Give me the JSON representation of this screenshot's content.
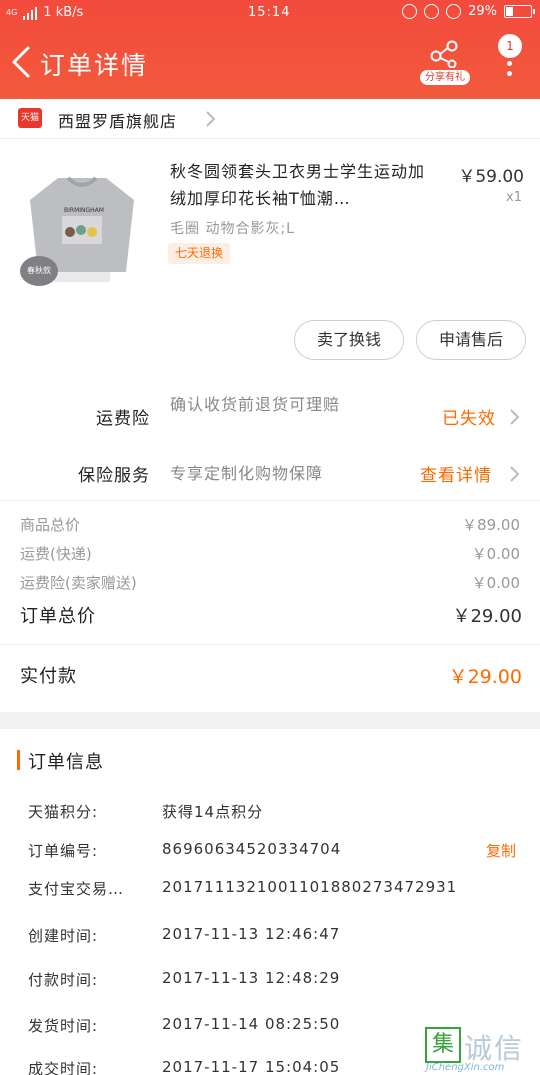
{
  "status_bar": {
    "network": "4G",
    "speed": "1 kB/s",
    "time": "15:14",
    "battery": "29%"
  },
  "header": {
    "title": "订单详情",
    "share_label": "分享有礼",
    "message_count": "1"
  },
  "shop": {
    "platform": "天猫",
    "name": "西盟罗盾旗舰店"
  },
  "product": {
    "title": "秋冬圆领套头卫衣男士学生运动加绒加厚印花长袖T恤潮…",
    "price": "￥59.00",
    "quantity": "x1",
    "sku": "毛圈 动物合影灰;L",
    "tag": "七天退换",
    "image_text": "BIRMINGHAM",
    "image_badge": "春秋款"
  },
  "actions": {
    "refund": "卖了换钱",
    "after_sales": "申请售后"
  },
  "services": [
    {
      "label": "运费险",
      "desc": "确认收货前退货可理赔",
      "status": "已失效"
    },
    {
      "label": "保险服务",
      "desc": "专享定制化购物保障",
      "status": "查看详情"
    }
  ],
  "fees": [
    {
      "label": "商品总价",
      "value": "￥89.00"
    },
    {
      "label": "运费(快递)",
      "value": "￥0.00"
    },
    {
      "label": "运费险(卖家赠送)",
      "value": "￥0.00"
    }
  ],
  "total": {
    "label": "订单总价",
    "value": "￥29.00"
  },
  "paid": {
    "label": "实付款",
    "value": "￥29.00"
  },
  "order_info": {
    "title": "订单信息",
    "copy_label": "复制",
    "rows": [
      {
        "key": "天猫积分:",
        "value": "获得14点积分"
      },
      {
        "key": "订单编号:",
        "value": "86960634520334704"
      },
      {
        "key": "支付宝交易…",
        "value": "2017111321001101880273472931"
      },
      {
        "key": "创建时间:",
        "value": "2017-11-13 12:46:47"
      },
      {
        "key": "付款时间:",
        "value": "2017-11-13 12:48:29"
      },
      {
        "key": "发货时间:",
        "value": "2017-11-14 08:25:50"
      },
      {
        "key": "成交时间:",
        "value": "2017-11-17 15:04:05"
      }
    ]
  },
  "watermark": {
    "char": "集",
    "text": "诚信",
    "url": "JiChengXin.com"
  },
  "colors": {
    "header": "#f24a3d",
    "accent": "#ff6a00",
    "tmall": "#e8382b"
  }
}
